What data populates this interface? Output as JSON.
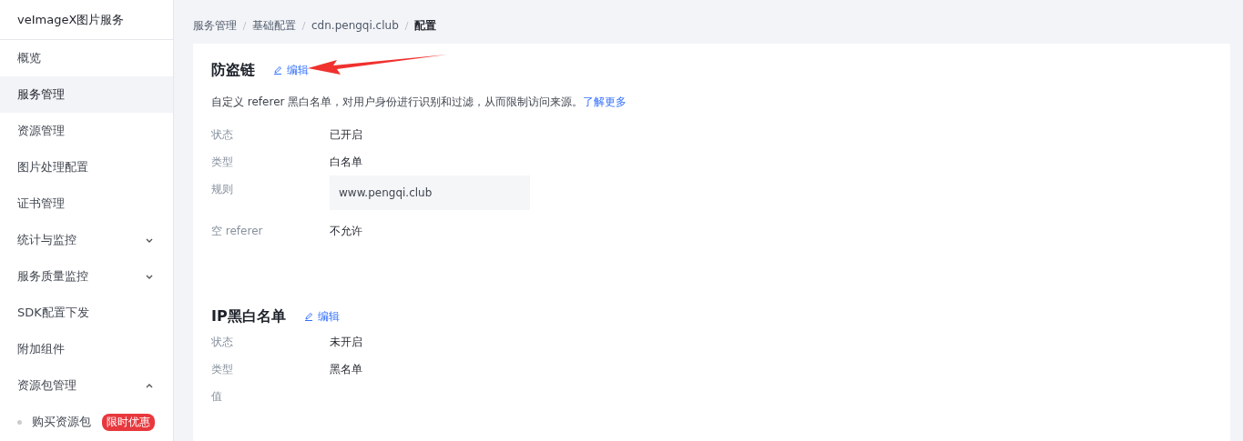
{
  "sidebar": {
    "title": "veImageX图片服务",
    "items": [
      {
        "label": "概览",
        "kind": "link",
        "selected": false
      },
      {
        "label": "服务管理",
        "kind": "link",
        "selected": true
      },
      {
        "label": "资源管理",
        "kind": "link",
        "selected": false
      },
      {
        "label": "图片处理配置",
        "kind": "link",
        "selected": false
      },
      {
        "label": "证书管理",
        "kind": "link",
        "selected": false
      },
      {
        "label": "统计与监控",
        "kind": "group",
        "selected": false,
        "expanded": false
      },
      {
        "label": "服务质量监控",
        "kind": "group",
        "selected": false,
        "expanded": false
      },
      {
        "label": "SDK配置下发",
        "kind": "link",
        "selected": false
      },
      {
        "label": "附加组件",
        "kind": "link",
        "selected": false
      },
      {
        "label": "资源包管理",
        "kind": "group",
        "selected": false,
        "expanded": true,
        "children": [
          {
            "label": "购买资源包",
            "badge": "限时优惠",
            "selected": false
          }
        ]
      }
    ]
  },
  "breadcrumb": [
    "服务管理",
    "基础配置",
    "cdn.pengqi.club",
    "配置"
  ],
  "sections": [
    {
      "title": "防盗链",
      "edit": "编辑",
      "description": "自定义 referer 黑白名单，对用户身份进行识别和过滤，从而限制访问来源。",
      "link": "了解更多",
      "annotated": true,
      "fields": [
        {
          "label": "状态",
          "value": "已开启",
          "kind": "text"
        },
        {
          "label": "类型",
          "value": "白名单",
          "kind": "text"
        },
        {
          "label": "规则",
          "value": "www.pengqi.club",
          "kind": "box"
        },
        {
          "label": "空 referer",
          "value": "不允许",
          "kind": "text"
        }
      ]
    },
    {
      "title": "IP黑白名单",
      "edit": "编辑",
      "fields": [
        {
          "label": "状态",
          "value": "未开启",
          "kind": "text"
        },
        {
          "label": "类型",
          "value": "黑名单",
          "kind": "text"
        },
        {
          "label": "值"
        }
      ]
    }
  ]
}
